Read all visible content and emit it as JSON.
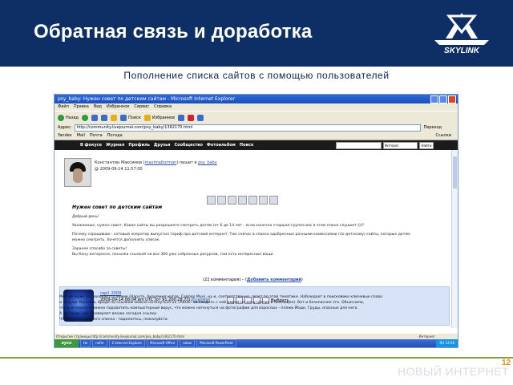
{
  "slide": {
    "title": "Обратная связь и доработка",
    "subtitle": "Пополнение списка сайтов с помощью пользователей",
    "logo_text": "SKYLINK",
    "footer": "НОВЫЙ ИНТЕРНЕТ",
    "page_number": "12",
    "colors": {
      "header": "#0d2f66",
      "accent_line": "#7aa33a",
      "page_num": "#e08a1c"
    }
  },
  "browser": {
    "window_title": "psy_baby: Нужен совет по детским сайтам - Microsoft Internet Explorer",
    "menu": [
      "Файл",
      "Правка",
      "Вид",
      "Избранное",
      "Сервис",
      "Справка"
    ],
    "toolbar": {
      "back": "Назад",
      "search": "Поиск",
      "favorites": "Избранное"
    },
    "address_label": "Адрес:",
    "address": "http://community.livejournal.com/psy_baby/1362170.html",
    "go": "Переход",
    "links_label": "Ссылки",
    "links": [
      "Yandex",
      "Mail",
      "Почта",
      "Погода"
    ],
    "lj_nav": [
      "В фокусе",
      "Журнал",
      "Профиль",
      "Друзья",
      "Сообщество",
      "Фотоальбом",
      "Поиск"
    ],
    "search_button": "Найти",
    "search_select": "Интерес"
  },
  "post": {
    "author_line": "Константин Максимов (",
    "author": "maximaltorman",
    "wrote_in": ") пишет в",
    "community": "psy_baby",
    "date": "@ 2009-09-14 11:57:00",
    "title": "Нужен совет по детским сайтам",
    "greeting": "Добрый день!",
    "p1": "Уважаемые, нужен совет. Какие сайты вы разрешаете смотреть детям (от 6 до 14 лет - если конечно старшая группа вас в этом плане слушает-)))?",
    "p2": "Почему спрашиваю - сотовый оператор выпустил тариф про детский интернет. Там сейчас в списке одобренные разными комиссиями (по детскому) сайты, которые детям можно смотреть. Хочется дополнить список.",
    "p3": "Заранее спасибо за советы!",
    "p4": "Вы Кону интересно, посылка ссылкой на все 300 уже собранных ресурсов, там есть интересные вещи",
    "comments_count": "(22 комментария)",
    "add_comment": "Добавить комментарий"
  },
  "comment": {
    "user": "rapil_2009",
    "date": "2009-09-14 08:04 am UTC (от 91.200.28.77)",
    "link": "ссылка",
    "select": "Выбрать",
    "text1": "Мой дочерке 11, увлекается аниме (Наруто, Академия магов, Сайлор Мун), ну и, соответственно, лезет по этой тематике. Наблюдает в поисковике ключевые слова",
    "text2": "и вперед. Конечно, бродя по ссылкам можно наткнуться на ТАКОЕ! но следить с ней рядом на кону (дочке в неплащее). Вот и безопаснее это. Объяснила,",
    "text3": "что в интернете можно подхватить компьютерный вирус, что можно наткнуться на фотографии для взрослых - пляжи Йошк, Груды, опасные для него.",
    "text4": "А не люди - ни. Проверяет вложи сегодня ссылки",
    "text5": "Что касается вашего списка - поделитесь, пожалуйста."
  },
  "status": {
    "text": "Открытие страницы http://community.livejournal.com/psy_baby/1362170.html",
    "zone": "Интернет"
  },
  "taskbar": {
    "start": "пуск",
    "tasks": [
      "tts",
      "nofm",
      "2 Internet Explorer",
      "Microsoft Office",
      "Inbox",
      "Microsoft PowerPoint"
    ],
    "clock": "RU 13:58"
  }
}
